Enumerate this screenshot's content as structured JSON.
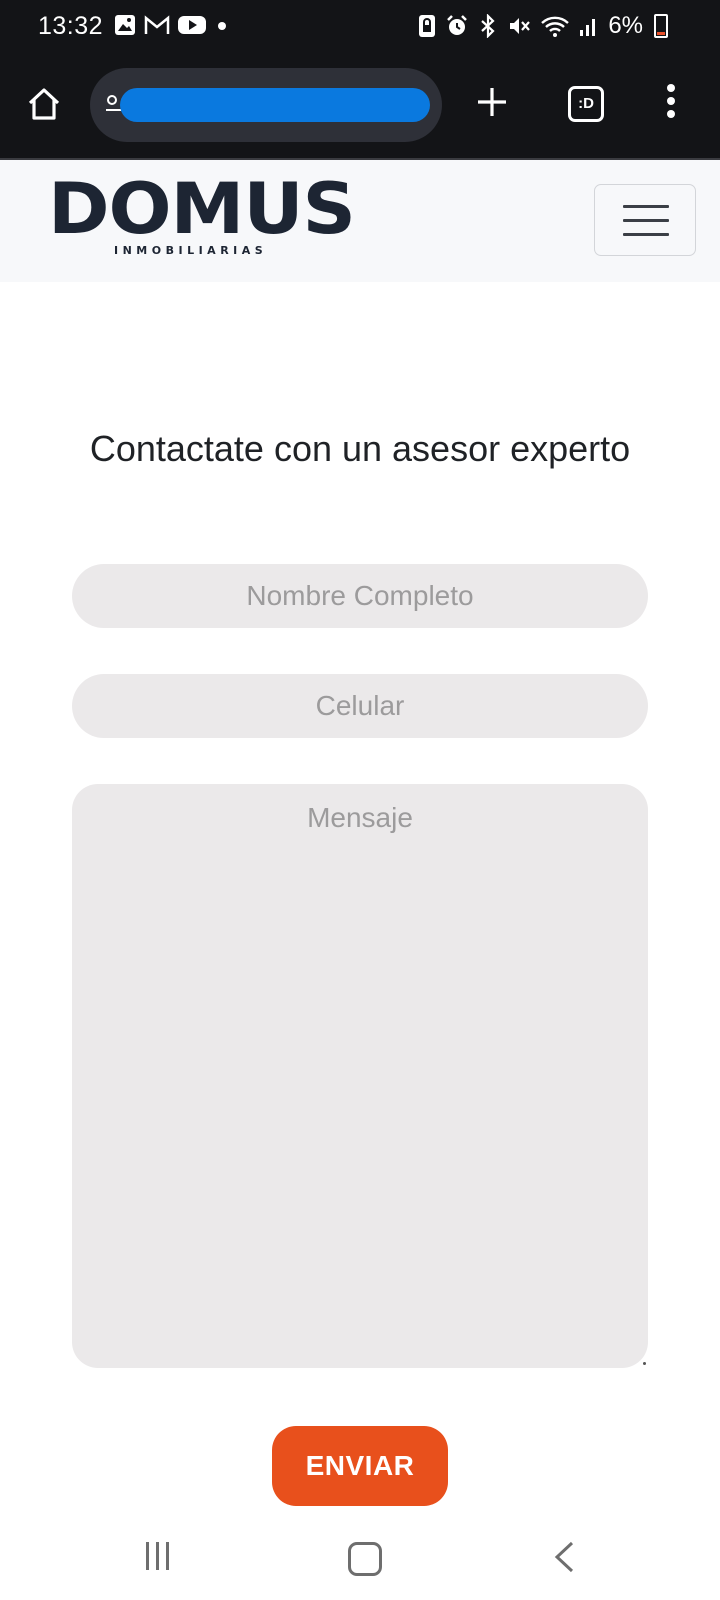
{
  "status_bar": {
    "time": "13:32",
    "left_icons": [
      "gallery-icon",
      "gmail-icon",
      "youtube-icon",
      "dot-icon"
    ],
    "right_icons": [
      "screen-lock-icon",
      "alarm-icon",
      "bluetooth-icon",
      "mute-icon",
      "wifi-icon",
      "signal-icon"
    ],
    "battery": "6%",
    "battery_color": "#e8512b"
  },
  "browser": {
    "url": "",
    "tab_button_label": ":D"
  },
  "site": {
    "logo_main": "DOMUS",
    "logo_sub": "INMOBILIARIAS"
  },
  "form": {
    "title": "Contactate con un asesor experto",
    "name_placeholder": "Nombre Completo",
    "phone_placeholder": "Celular",
    "message_placeholder": "Mensaje",
    "submit_label": "ENVIAR",
    "accent_color": "#e8501c"
  }
}
